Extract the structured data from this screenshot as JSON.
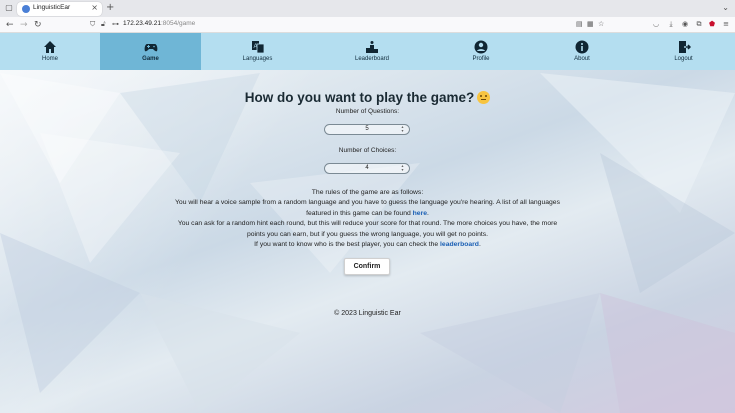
{
  "browser": {
    "tab_title": "LinguisticEar",
    "url_host": "172.23.49.21",
    "url_path": ":8054/game"
  },
  "nav": {
    "items": [
      {
        "label": "Home",
        "icon": "home-icon"
      },
      {
        "label": "Game",
        "icon": "gamepad-icon",
        "active": true
      },
      {
        "label": "Languages",
        "icon": "translate-icon"
      },
      {
        "label": "Leaderboard",
        "icon": "podium-icon"
      },
      {
        "label": "Profile",
        "icon": "user-icon"
      },
      {
        "label": "About",
        "icon": "info-icon"
      },
      {
        "label": "Logout",
        "icon": "logout-icon"
      }
    ],
    "color": "#b4def0",
    "active_color": "#6fb6d6"
  },
  "game": {
    "title": "How do you want to play the game?",
    "questions_label": "Number of Questions:",
    "questions_value": "5",
    "choices_label": "Number of Choices:",
    "choices_value": "4",
    "rules": {
      "line1": "The rules of the game are as follows:",
      "line2_pre": "You will hear a voice sample from a random language and you have to guess the language you're hearing. A list of all languages featured in this game can be found ",
      "line2_link": "here",
      "line2_post": ".",
      "line3": "You can ask for a random hint each round, but this will reduce your score for that round. The more choices you have, the more points you can earn, but if you guess the wrong language, you will get no points.",
      "line4_pre": "If you want to know who is the best player, you can check the ",
      "line4_link": "leaderboard",
      "line4_post": "."
    },
    "confirm_label": "Confirm"
  },
  "footer": "© 2023 Linguistic Ear"
}
